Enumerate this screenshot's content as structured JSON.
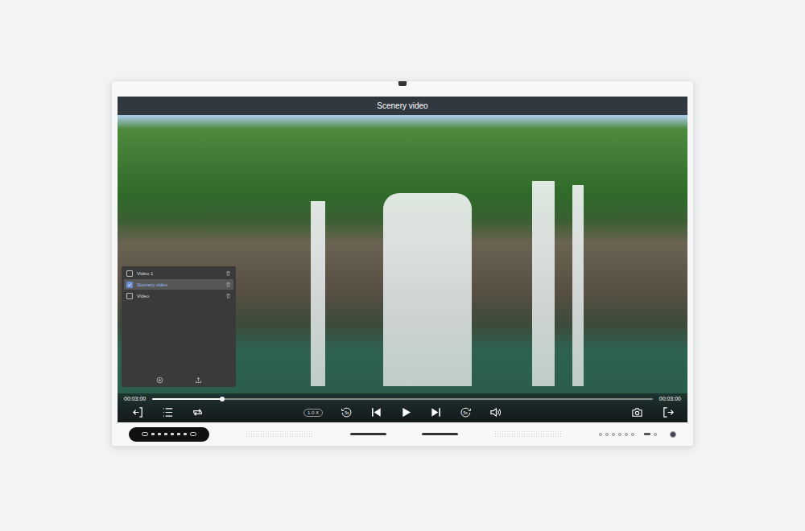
{
  "window": {
    "title": "Scenery video"
  },
  "playlist": {
    "items": [
      {
        "label": "Video 1",
        "checked": false,
        "selected": false
      },
      {
        "label": "Scenery video",
        "checked": true,
        "selected": true
      },
      {
        "label": "Video",
        "checked": false,
        "selected": false
      }
    ]
  },
  "player": {
    "elapsed": "00:03:00",
    "total": "00:03:00",
    "level": 0.14,
    "speed": "1.0 X",
    "rewind": "5s",
    "forward": "5s",
    "playing": false
  }
}
